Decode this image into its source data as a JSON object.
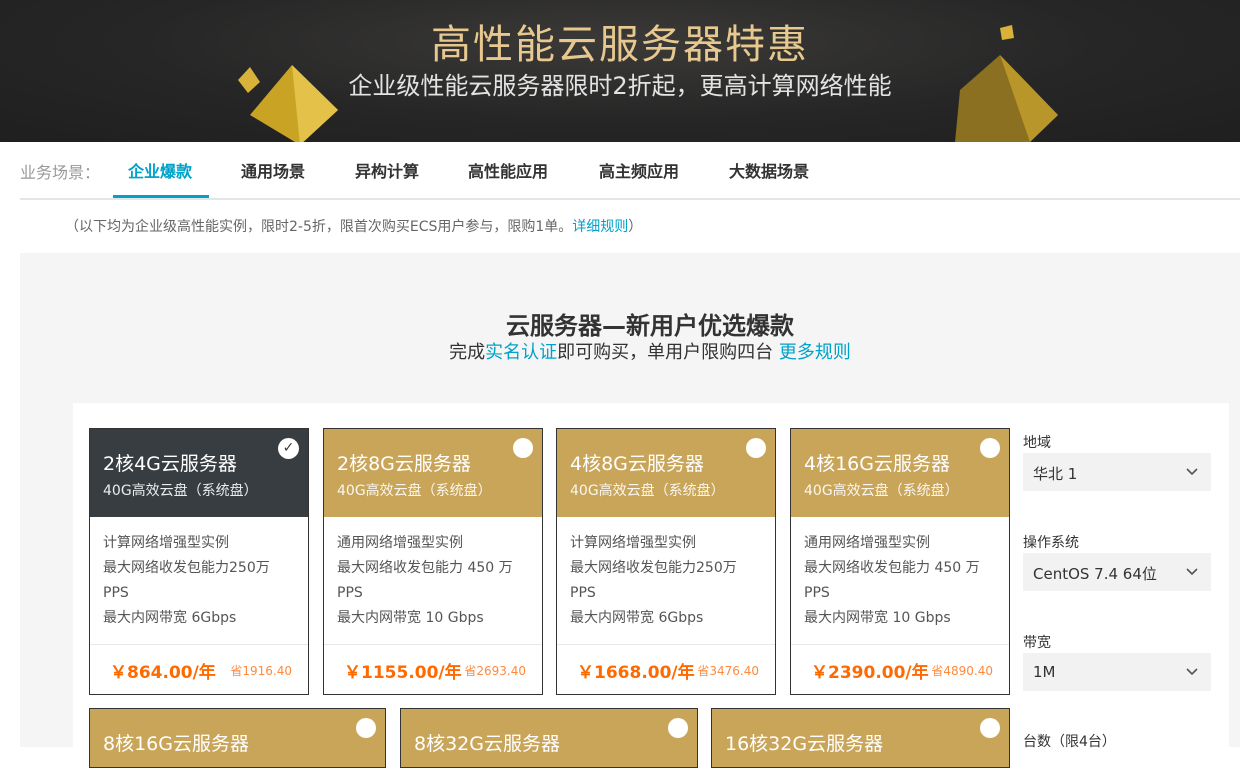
{
  "banner": {
    "title": "高性能云服务器特惠",
    "subtitle": "企业级性能云服务器限时2折起，更高计算网络性能"
  },
  "tabs": {
    "label": "业务场景：",
    "items": [
      "企业爆款",
      "通用场景",
      "异构计算",
      "高性能应用",
      "高主频应用",
      "大数据场景"
    ],
    "active_index": 0
  },
  "notice": {
    "text": "（以下均为企业级高性能实例，限时2-5折，限首次购买ECS用户参与，限购1单。",
    "link": "详细规则",
    "close": "）"
  },
  "section": {
    "title": "云服务器—新用户优选爆款",
    "sub_prefix": "完成",
    "sub_link1": "实名认证",
    "sub_middle": "即可购买，单用户限购四台",
    "sub_link2": "更多规则"
  },
  "cards": [
    {
      "title": "2核4G云服务器",
      "disk": "40G高效云盘（系统盘）",
      "line1": "计算网络增强型实例",
      "line2": "最大网络收发包能力250万",
      "line3": "PPS",
      "line4": "最大内网带宽 6Gbps",
      "price": "￥864.00/年",
      "save": "省1916.40",
      "selected": true
    },
    {
      "title": "2核8G云服务器",
      "disk": "40G高效云盘（系统盘）",
      "line1": "通用网络增强型实例",
      "line2": "最大网络收发包能力 450 万",
      "line3": "PPS",
      "line4": "最大内网带宽 10 Gbps",
      "price": "￥1155.00/年",
      "save": "省2693.40",
      "selected": false
    },
    {
      "title": "4核8G云服务器",
      "disk": "40G高效云盘（系统盘）",
      "line1": "计算网络增强型实例",
      "line2": "最大网络收发包能力250万",
      "line3": "PPS",
      "line4": "最大内网带宽 6Gbps",
      "price": "￥1668.00/年",
      "save": "省3476.40",
      "selected": false
    },
    {
      "title": "4核16G云服务器",
      "disk": "40G高效云盘（系统盘）",
      "line1": "通用网络增强型实例",
      "line2": "最大网络收发包能力 450 万",
      "line3": "PPS",
      "line4": "最大内网带宽 10 Gbps",
      "price": "￥2390.00/年",
      "save": "省4890.40",
      "selected": false
    }
  ],
  "cards_row2": [
    {
      "title": "8核16G云服务器"
    },
    {
      "title": "8核32G云服务器"
    },
    {
      "title": "16核32G云服务器"
    }
  ],
  "options": {
    "region_label": "地域",
    "region_value": "华北 1",
    "os_label": "操作系统",
    "os_value": "CentOS 7.4 64位",
    "bandwidth_label": "带宽",
    "bandwidth_value": "1M",
    "quantity_label": "台数（限4台）"
  },
  "icons": {
    "chevron": "chevron-down-icon",
    "check": "checkmark-icon",
    "radio": "radio-circle-icon"
  },
  "colors": {
    "accent": "#00a2ca",
    "gold": "#c9a55a",
    "dark": "#373d41",
    "price": "#ff6a00"
  }
}
